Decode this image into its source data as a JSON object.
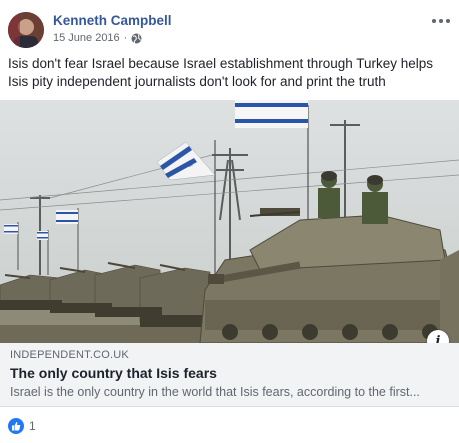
{
  "post": {
    "author": "Kenneth Campbell",
    "date": "15 June 2016",
    "separator": "·",
    "privacy_icon": "globe-icon",
    "more_icon": "more-options-icon",
    "text": "Isis don't fear Israel because Israel establishment through Turkey helps Isis pity independent journalists don't look for and print the truth"
  },
  "link_preview": {
    "domain": "INDEPENDENT.CO.UK",
    "title": "The only country that Isis fears",
    "description": "Israel is the only country in the world that Isis fears, according to the first...",
    "info_icon": "i"
  },
  "reactions": {
    "icon": "like-icon",
    "count": "1"
  },
  "colors": {
    "author_link": "#365899",
    "like_blue": "#2078f4",
    "link_box_bg": "#f2f3f5",
    "muted_text": "#606770"
  }
}
